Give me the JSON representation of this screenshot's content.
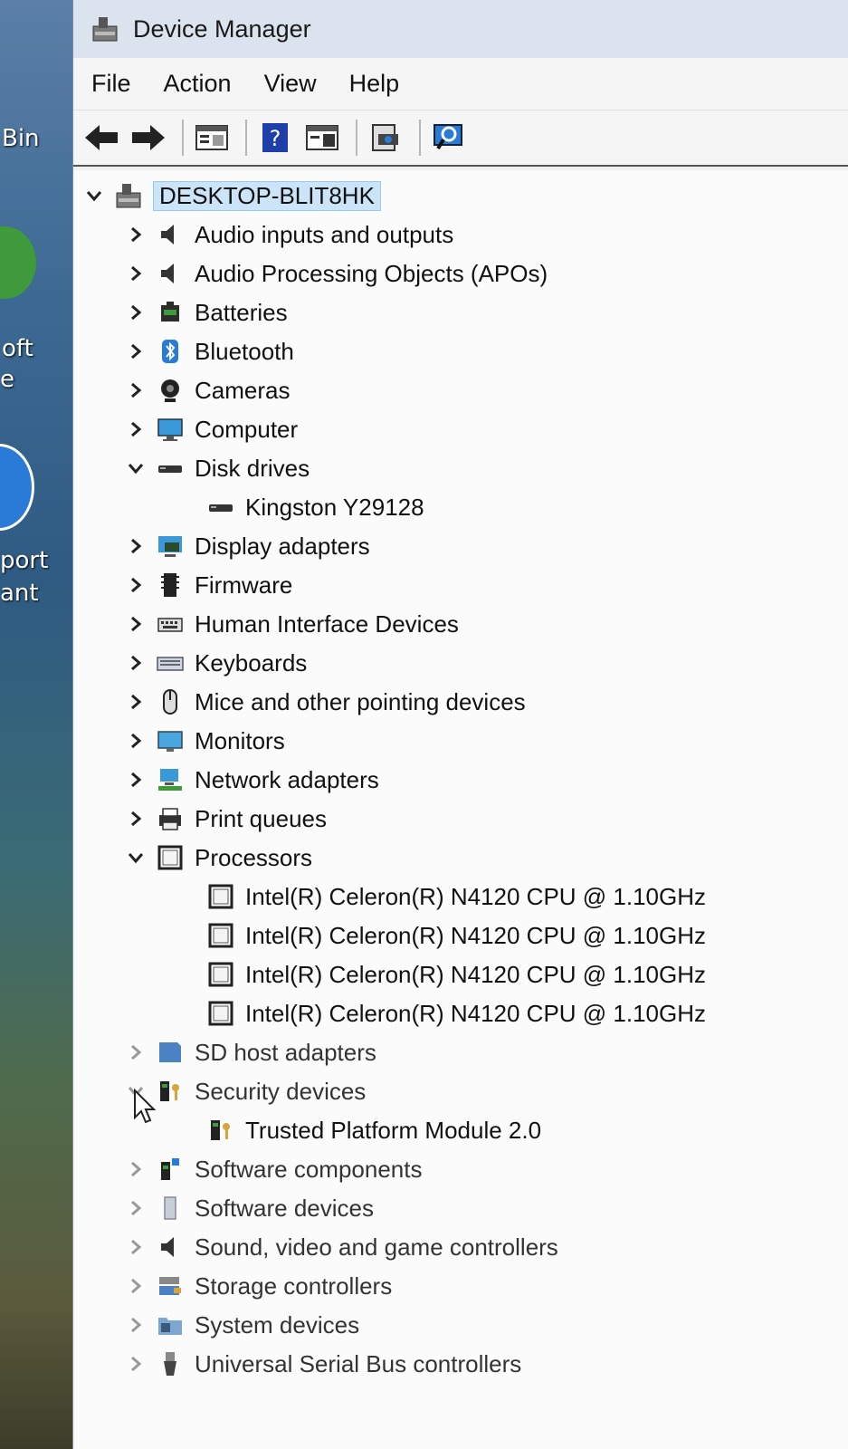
{
  "desktop": {
    "labels": [
      "Bin",
      "oft",
      "e",
      "port",
      "ant"
    ]
  },
  "window": {
    "title": "Device Manager"
  },
  "menu": [
    "File",
    "Action",
    "View",
    "Help"
  ],
  "toolbar": {
    "buttons": [
      "back-arrow-icon",
      "forward-arrow-icon",
      "properties-icon",
      "help-icon",
      "show-hide-console-tree-icon",
      "update-driver-icon",
      "scan-hardware-icon"
    ]
  },
  "tree": {
    "root": "DESKTOP-BLIT8HK",
    "categories": [
      {
        "label": "Audio inputs and outputs",
        "expanded": false,
        "icon": "speaker-icon"
      },
      {
        "label": "Audio Processing Objects (APOs)",
        "expanded": false,
        "icon": "speaker-icon"
      },
      {
        "label": "Batteries",
        "expanded": false,
        "icon": "battery-icon"
      },
      {
        "label": "Bluetooth",
        "expanded": false,
        "icon": "bluetooth-icon"
      },
      {
        "label": "Cameras",
        "expanded": false,
        "icon": "camera-icon"
      },
      {
        "label": "Computer",
        "expanded": false,
        "icon": "computer-icon"
      },
      {
        "label": "Disk drives",
        "expanded": true,
        "icon": "disk-icon",
        "children": [
          "Kingston Y29128"
        ]
      },
      {
        "label": "Display adapters",
        "expanded": false,
        "icon": "display-adapter-icon"
      },
      {
        "label": "Firmware",
        "expanded": false,
        "icon": "firmware-icon"
      },
      {
        "label": "Human Interface Devices",
        "expanded": false,
        "icon": "hid-icon"
      },
      {
        "label": "Keyboards",
        "expanded": false,
        "icon": "keyboard-icon"
      },
      {
        "label": "Mice and other pointing devices",
        "expanded": false,
        "icon": "mouse-icon"
      },
      {
        "label": "Monitors",
        "expanded": false,
        "icon": "monitor-icon"
      },
      {
        "label": "Network adapters",
        "expanded": false,
        "icon": "network-icon"
      },
      {
        "label": "Print queues",
        "expanded": false,
        "icon": "printer-icon"
      },
      {
        "label": "Processors",
        "expanded": true,
        "icon": "processor-icon",
        "children": [
          "Intel(R) Celeron(R) N4120 CPU @ 1.10GHz",
          "Intel(R) Celeron(R) N4120 CPU @ 1.10GHz",
          "Intel(R) Celeron(R) N4120 CPU @ 1.10GHz",
          "Intel(R) Celeron(R) N4120 CPU @ 1.10GHz"
        ]
      },
      {
        "label": "SD host adapters",
        "expanded": false,
        "icon": "sd-icon"
      },
      {
        "label": "Security devices",
        "expanded": true,
        "icon": "security-icon",
        "children": [
          "Trusted Platform Module 2.0"
        ]
      },
      {
        "label": "Software components",
        "expanded": false,
        "icon": "software-component-icon"
      },
      {
        "label": "Software devices",
        "expanded": false,
        "icon": "software-device-icon"
      },
      {
        "label": "Sound, video and game controllers",
        "expanded": false,
        "icon": "speaker-icon"
      },
      {
        "label": "Storage controllers",
        "expanded": false,
        "icon": "storage-icon"
      },
      {
        "label": "System devices",
        "expanded": false,
        "icon": "system-folder-icon"
      },
      {
        "label": "Universal Serial Bus controllers",
        "expanded": false,
        "icon": "usb-icon"
      }
    ]
  },
  "colors": {
    "selection": "#cce4f7",
    "window_bg": "#fbfbfb",
    "titlebar": "#dbe4ee"
  }
}
